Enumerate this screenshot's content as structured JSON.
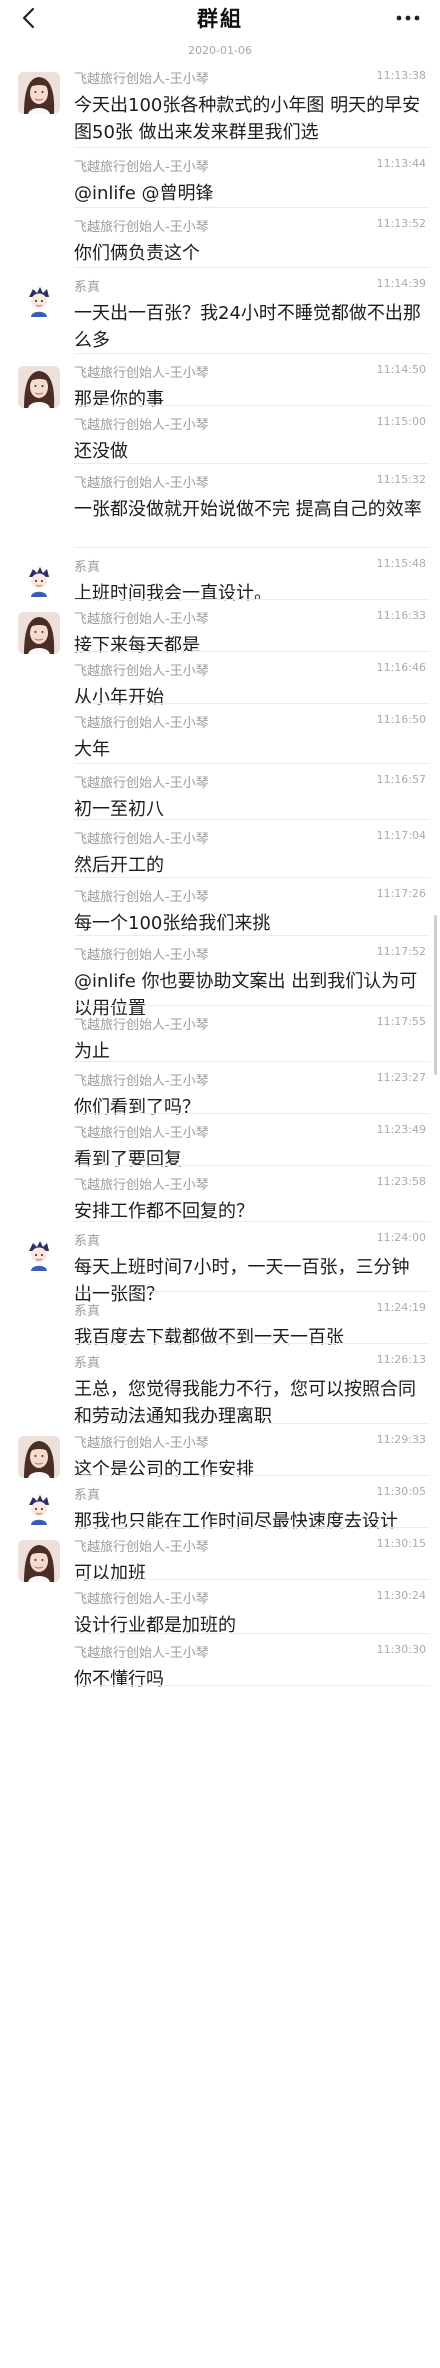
{
  "header": {
    "title": "群組"
  },
  "date_separator": "2020-01-06",
  "messages": [
    {
      "sender": "飞越旅行创始人-王小琴",
      "time": "11:13:38",
      "text": "今天出100张各种款式的小年图 明天的早安图50张 做出来发来群里我们选",
      "avatar": "girl"
    },
    {
      "sender": "飞越旅行创始人-王小琴",
      "time": "11:13:44",
      "text": "@inlife @曾明锋",
      "avatar": ""
    },
    {
      "sender": "飞越旅行创始人-王小琴",
      "time": "11:13:52",
      "text": "你们俩负责这个",
      "avatar": ""
    },
    {
      "sender": "系真",
      "time": "11:14:39",
      "text": "一天出一百张？我24小时不睡觉都做不出那么多",
      "avatar": "boy"
    },
    {
      "sender": "飞越旅行创始人-王小琴",
      "time": "11:14:50",
      "text": "那是你的事",
      "avatar": "girl"
    },
    {
      "sender": "飞越旅行创始人-王小琴",
      "time": "11:15:00",
      "text": "还没做",
      "avatar": ""
    },
    {
      "sender": "飞越旅行创始人-王小琴",
      "time": "11:15:32",
      "text": "一张都没做就开始说做不完 提高自己的效率",
      "avatar": ""
    },
    {
      "sender": "系真",
      "time": "11:15:48",
      "text": "上班时间我会一直设计。",
      "avatar": "boy"
    },
    {
      "sender": "飞越旅行创始人-王小琴",
      "time": "11:16:33",
      "text": "接下来每天都是",
      "avatar": "girl"
    },
    {
      "sender": "飞越旅行创始人-王小琴",
      "time": "11:16:46",
      "text": "从小年开始",
      "avatar": ""
    },
    {
      "sender": "飞越旅行创始人-王小琴",
      "time": "11:16:50",
      "text": "大年",
      "avatar": ""
    },
    {
      "sender": "飞越旅行创始人-王小琴",
      "time": "11:16:57",
      "text": "初一至初八",
      "avatar": ""
    },
    {
      "sender": "飞越旅行创始人-王小琴",
      "time": "11:17:04",
      "text": "然后开工的",
      "avatar": ""
    },
    {
      "sender": "飞越旅行创始人-王小琴",
      "time": "11:17:26",
      "text": "每一个100张给我们来挑",
      "avatar": ""
    },
    {
      "sender": "飞越旅行创始人-王小琴",
      "time": "11:17:52",
      "text": "@inlife 你也要协助文案出 出到我们认为可以用位置",
      "avatar": ""
    },
    {
      "sender": "飞越旅行创始人-王小琴",
      "time": "11:17:55",
      "text": "为止",
      "avatar": ""
    },
    {
      "sender": "飞越旅行创始人-王小琴",
      "time": "11:23:27",
      "text": "你们看到了吗？",
      "avatar": ""
    },
    {
      "sender": "飞越旅行创始人-王小琴",
      "time": "11:23:49",
      "text": "看到了要回复",
      "avatar": ""
    },
    {
      "sender": "飞越旅行创始人-王小琴",
      "time": "11:23:58",
      "text": "安排工作都不回复的？",
      "avatar": ""
    },
    {
      "sender": "系真",
      "time": "11:24:00",
      "text": "每天上班时间7小时，一天一百张，三分钟出一张图？",
      "avatar": "boy"
    },
    {
      "sender": "系真",
      "time": "11:24:19",
      "text": "我百度去下载都做不到一天一百张",
      "avatar": ""
    },
    {
      "sender": "系真",
      "time": "11:26:13",
      "text": "王总，您觉得我能力不行，您可以按照合同和劳动法通知我办理离职",
      "avatar": ""
    },
    {
      "sender": "飞越旅行创始人-王小琴",
      "time": "11:29:33",
      "text": "这个是公司的工作安排",
      "avatar": "girl"
    },
    {
      "sender": "系真",
      "time": "11:30:05",
      "text": "那我也只能在工作时间尽最快速度去设计",
      "avatar": "boy"
    },
    {
      "sender": "飞越旅行创始人-王小琴",
      "time": "11:30:15",
      "text": "可以加班",
      "avatar": "girl"
    },
    {
      "sender": "飞越旅行创始人-王小琴",
      "time": "11:30:24",
      "text": "设计行业都是加班的",
      "avatar": ""
    },
    {
      "sender": "飞越旅行创始人-王小琴",
      "time": "11:30:30",
      "text": "你不懂行吗",
      "avatar": ""
    }
  ]
}
